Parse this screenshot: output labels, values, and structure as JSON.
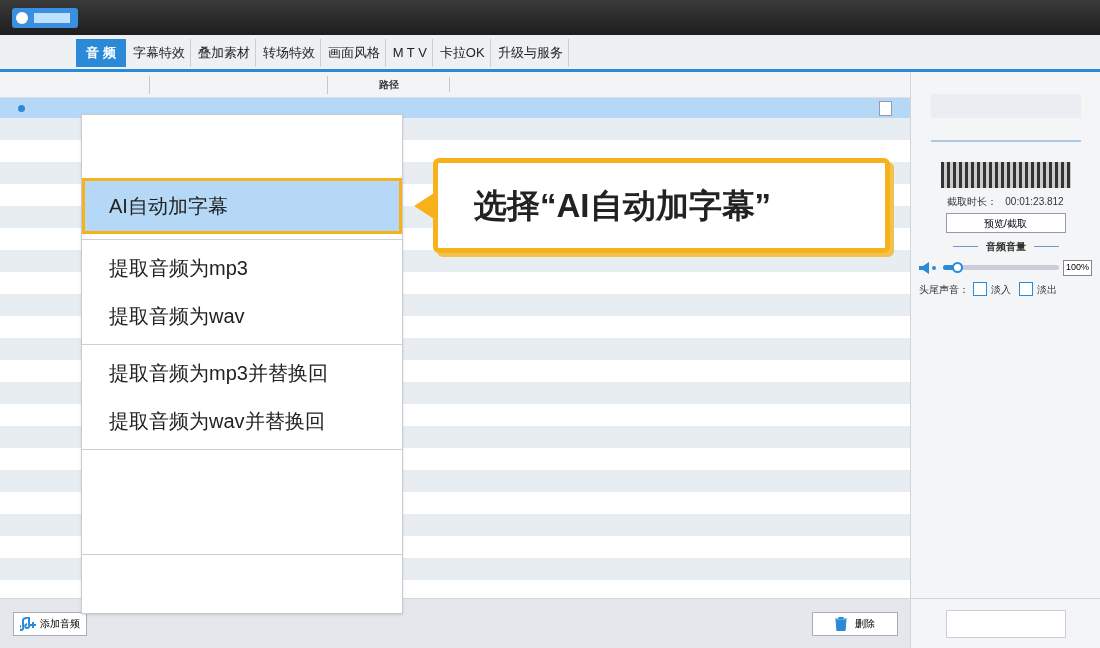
{
  "tabs": [
    {
      "label": "音 频",
      "selected": true
    },
    {
      "label": "字幕特效",
      "selected": false
    },
    {
      "label": "叠加素材",
      "selected": false
    },
    {
      "label": "转场特效",
      "selected": false
    },
    {
      "label": "画面风格",
      "selected": false
    },
    {
      "label": "M T V",
      "selected": false
    },
    {
      "label": "卡拉OK",
      "selected": false
    },
    {
      "label": "升级与服务",
      "selected": false
    }
  ],
  "table": {
    "columns": [
      "路径"
    ],
    "rows": [
      {
        "selected": true
      }
    ]
  },
  "context_menu": {
    "groups": [
      [
        {
          "label": "AI自动加字幕",
          "selected": true
        }
      ],
      [
        {
          "label": "提取音频为mp3",
          "selected": false
        },
        {
          "label": "提取音频为wav",
          "selected": false
        }
      ],
      [
        {
          "label": "提取音频为mp3并替换回",
          "selected": false
        },
        {
          "label": "提取音频为wav并替换回",
          "selected": false
        }
      ]
    ]
  },
  "callout": "选择“AI自动加字幕”",
  "side_panel": {
    "duration_label": "截取时长：",
    "duration": "00:01:23.812",
    "preview_button": "预览/截取",
    "volume_title": "音频音量",
    "volume": {
      "level": 0.12
    },
    "volume_reading": "100%",
    "fade_label": "头尾声音：",
    "fades": [
      {
        "label": "淡入",
        "checked": false
      },
      {
        "label": "淡出",
        "checked": false
      }
    ]
  },
  "bottom_bar": {
    "add_button": "添加音频",
    "delete_button": "删除"
  }
}
